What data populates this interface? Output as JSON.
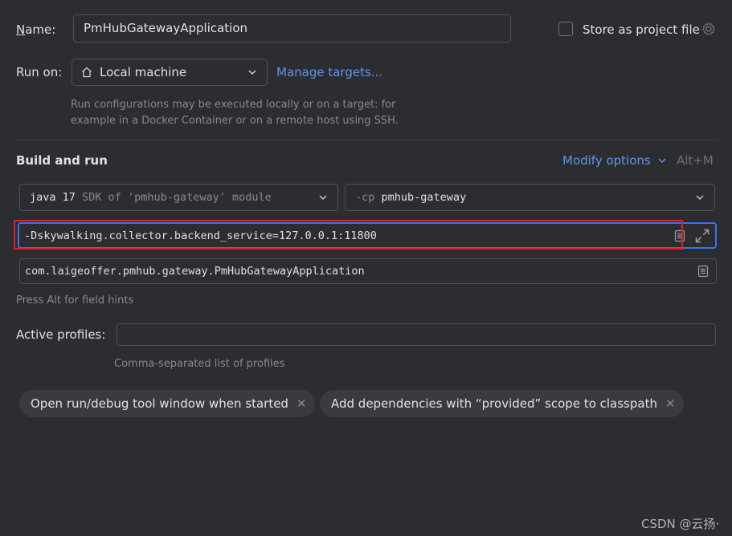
{
  "name": {
    "label_prefix": "N",
    "label_rest": "ame:",
    "value": "PmHubGatewayApplication"
  },
  "store": {
    "label": "Store as project file",
    "checked": false
  },
  "run_on": {
    "label": "Run on:",
    "target": "Local machine",
    "manage_link": "Manage targets...",
    "hint_line1": "Run configurations may be executed locally or on a target: for",
    "hint_line2": "example in a Docker Container or on a remote host using SSH."
  },
  "build": {
    "title": "Build and run",
    "modify_options": "Modify options",
    "shortcut": "Alt+M",
    "sdk": {
      "java": "java 17",
      "rest": "SDK of 'pmhub-gateway' module"
    },
    "classpath": {
      "flag": "-cp",
      "module": "pmhub-gateway"
    },
    "vm_options": "-Dskywalking.collector.backend_service=127.0.0.1:11800",
    "main_class": "com.laigeoffer.pmhub.gateway.PmHubGatewayApplication",
    "field_hint": "Press Alt for field hints"
  },
  "profiles": {
    "label": "Active profiles:",
    "value": "",
    "hint": "Comma-separated list of profiles"
  },
  "chips": [
    {
      "label": "Open run/debug tool window when started"
    },
    {
      "label": "Add dependencies with “provided” scope to classpath"
    }
  ],
  "watermark": "CSDN @云扬·",
  "colors": {
    "background": "#2b2d30",
    "link": "#5f96e9",
    "focus_border": "#3574f0",
    "highlight_box": "#e0202a"
  }
}
